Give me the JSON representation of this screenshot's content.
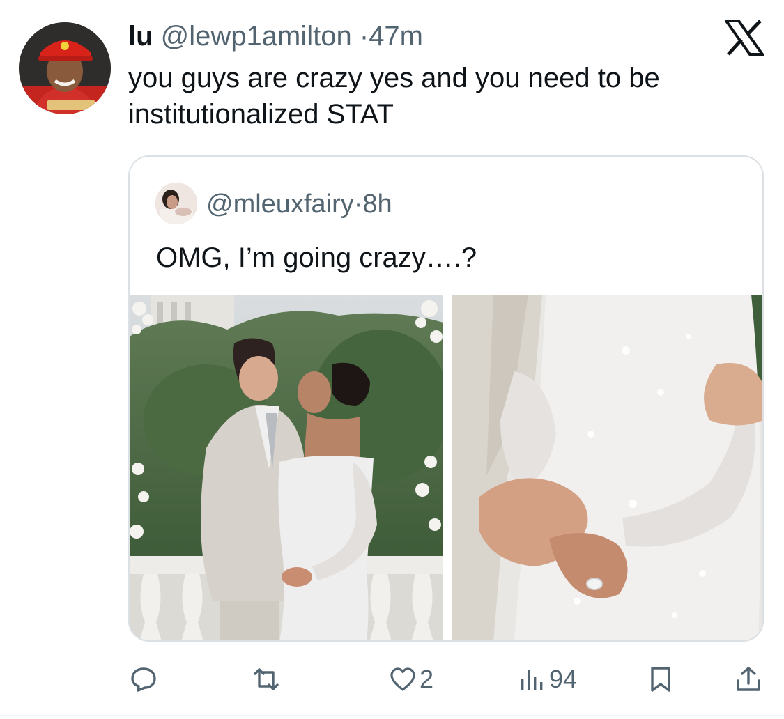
{
  "tweet": {
    "author_name": "lu",
    "author_handle": "@lewp1amilton",
    "separator": "·",
    "time": "47m",
    "text": "you guys are crazy yes and you need to be institutionalized STAT",
    "avatar_icon": "profile-avatar",
    "brand_icon": "x-logo-icon"
  },
  "quoted": {
    "author_handle": "@mleuxfairy",
    "separator": "·",
    "time": "8h",
    "text": "OMG, I’m going crazy….?",
    "avatar_icon": "profile-avatar",
    "images": [
      {
        "description_icon": "wedding-kiss-photo"
      },
      {
        "description_icon": "wedding-hands-photo"
      }
    ]
  },
  "actions": {
    "reply": {
      "icon": "reply-icon",
      "count": ""
    },
    "retweet": {
      "icon": "retweet-icon",
      "count": ""
    },
    "like": {
      "icon": "heart-icon",
      "count": "2"
    },
    "views": {
      "icon": "views-icon",
      "count": "94"
    },
    "bookmark": {
      "icon": "bookmark-icon",
      "count": ""
    },
    "share": {
      "icon": "share-icon",
      "count": ""
    }
  },
  "colors": {
    "text_primary": "#0f1419",
    "text_secondary": "#536471",
    "border": "#dbe0e4"
  }
}
